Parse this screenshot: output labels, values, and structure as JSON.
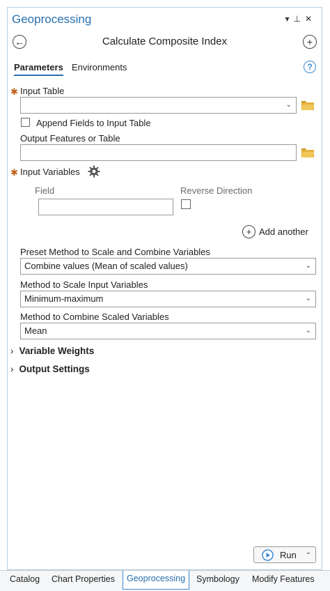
{
  "header": {
    "title": "Geoprocessing",
    "tool_title": "Calculate Composite Index"
  },
  "tabs": [
    {
      "label": "Parameters",
      "active": true
    },
    {
      "label": "Environments",
      "active": false
    }
  ],
  "params": {
    "input_table": {
      "label": "Input Table",
      "value": ""
    },
    "append_fields": {
      "label": "Append Fields to Input Table",
      "checked": false
    },
    "output_features": {
      "label": "Output Features or Table",
      "value": ""
    },
    "input_variables": {
      "label": "Input Variables",
      "field_header": "Field",
      "reverse_header": "Reverse Direction",
      "field_value": "",
      "reverse_checked": false,
      "add_another": "Add another"
    },
    "preset_method": {
      "label": "Preset Method to Scale and Combine Variables",
      "value": "Combine values (Mean of scaled values)"
    },
    "scale_method": {
      "label": "Method to Scale Input Variables",
      "value": "Minimum-maximum"
    },
    "combine_method": {
      "label": "Method to Combine Scaled Variables",
      "value": "Mean"
    }
  },
  "sections": [
    {
      "label": "Variable Weights",
      "expanded": false
    },
    {
      "label": "Output Settings",
      "expanded": false
    }
  ],
  "run_button": {
    "label": "Run"
  },
  "bottom_tabs": [
    {
      "label": "Catalog",
      "active": false
    },
    {
      "label": "Chart Properties",
      "active": false
    },
    {
      "label": "Geoprocessing",
      "active": true
    },
    {
      "label": "Symbology",
      "active": false
    },
    {
      "label": "Modify Features",
      "active": false
    }
  ],
  "colors": {
    "accent": "#2a6fb0",
    "required_marker": "#c0601a",
    "folder": "#e3b23c"
  }
}
